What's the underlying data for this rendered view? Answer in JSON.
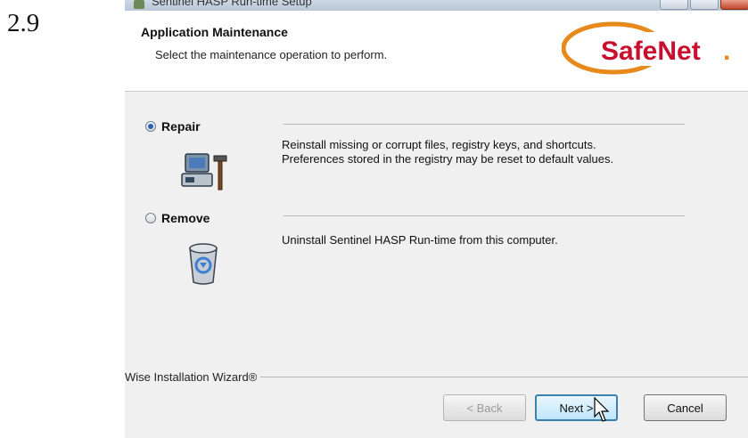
{
  "step_number": "2.9",
  "window": {
    "title": "Sentinel HASP Run-time Setup"
  },
  "header": {
    "title": "Application Maintenance",
    "subtitle": "Select the maintenance operation to perform.",
    "logo_text": "SafeNet",
    "logo_dot": "."
  },
  "options": [
    {
      "label": "Repair",
      "selected": true,
      "description_line1": "Reinstall missing or corrupt files, registry keys, and shortcuts.",
      "description_line2": "Preferences stored in the registry may be reset to default values.",
      "icon": "repair-tools-icon"
    },
    {
      "label": "Remove",
      "selected": false,
      "description_line1": "Uninstall Sentinel HASP Run-time from this computer.",
      "icon": "recycle-bin-icon"
    }
  ],
  "footer": {
    "wizard_label": "Wise Installation Wizard®"
  },
  "buttons": {
    "back": "< Back",
    "next": "Next >",
    "cancel": "Cancel"
  },
  "colors": {
    "logo_orange": "#e8891c",
    "logo_red": "#c8102e",
    "focus_blue": "#3c7fb1"
  }
}
